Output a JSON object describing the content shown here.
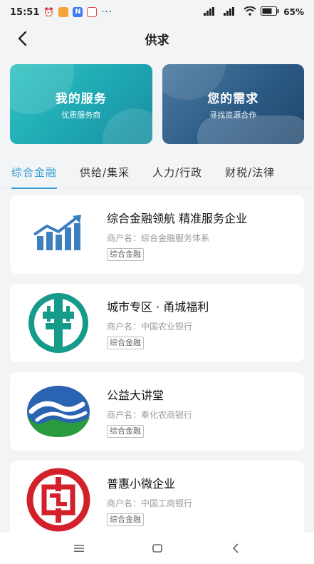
{
  "status": {
    "time": "15:51",
    "more": "···",
    "battery": "65%"
  },
  "header": {
    "title": "供求"
  },
  "banners": [
    {
      "title": "我的服务",
      "subtitle": "优质服务商"
    },
    {
      "title": "您的需求",
      "subtitle": "寻找资源合作"
    }
  ],
  "tabs": [
    {
      "label": "综合金融",
      "active": true
    },
    {
      "label": "供给/集采",
      "active": false
    },
    {
      "label": "人力/行政",
      "active": false
    },
    {
      "label": "财税/法律",
      "active": false
    }
  ],
  "cards": [
    {
      "title": "综合金融领航 精准服务企业",
      "merchant": "商户名：综合金融服务体系",
      "tag": "综合金融",
      "logo": "chart-growth-icon"
    },
    {
      "title": "城市专区 · 甬城福利",
      "merchant": "商户名：中国农业银行",
      "tag": "综合金融",
      "logo": "abc-bank-logo"
    },
    {
      "title": "公益大讲堂",
      "merchant": "商户名：奉化农商银行",
      "tag": "综合金融",
      "logo": "rural-bank-logo"
    },
    {
      "title": "普惠小微企业",
      "merchant": "商户名：中国工商银行",
      "tag": "综合金融",
      "logo": "icbc-logo"
    }
  ],
  "colors": {
    "accent": "#2f9fd6",
    "banner_service": "#25b5b9",
    "banner_demand": "#2c5b86"
  }
}
